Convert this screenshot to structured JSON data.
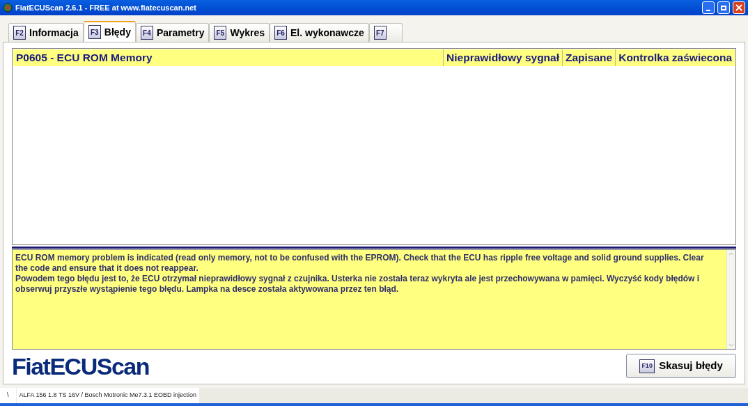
{
  "window": {
    "title": "FiatECUScan 2.6.1 - FREE at www.fiatecuscan.net"
  },
  "tabs": [
    {
      "key": "F2",
      "label": "Informacja",
      "selected": false
    },
    {
      "key": "F3",
      "label": "Błędy",
      "selected": true
    },
    {
      "key": "F4",
      "label": "Parametry",
      "selected": false
    },
    {
      "key": "F5",
      "label": "Wykres",
      "selected": false
    },
    {
      "key": "F6",
      "label": "El. wykonawcze",
      "selected": false
    },
    {
      "key": "F7",
      "selected": false
    }
  ],
  "table": {
    "columns": [
      "P0605 - ECU ROM Memory",
      "Nieprawidłowy sygnał",
      "Zapisane",
      "Kontrolka zaświecona"
    ]
  },
  "description": [
    "ECU ROM memory problem is indicated (read only memory, not to be confused with the EPROM). Check that the ECU has ripple free voltage and solid ground supplies. Clear the code and ensure that it does not reappear.",
    "Powodem tego błędu jest to, że ECU otrzymał nieprawidłowy sygnał z czujnika. Usterka nie została teraz wykryta ale jest przechowywana w pamięci. Wyczyść kody błędów i obserwuj przyszłe wystąpienie tego błędu. Lampka na desce została aktywowana przez ten błąd."
  ],
  "logo": "FiatECUScan",
  "clear_button": {
    "key": "F10",
    "label": "Skasuj błędy"
  },
  "status_bar": [
    "\\",
    "ALFA 156 1.8 TS 16V / Bosch Motronic Me7.3.1 EOBD injection"
  ]
}
